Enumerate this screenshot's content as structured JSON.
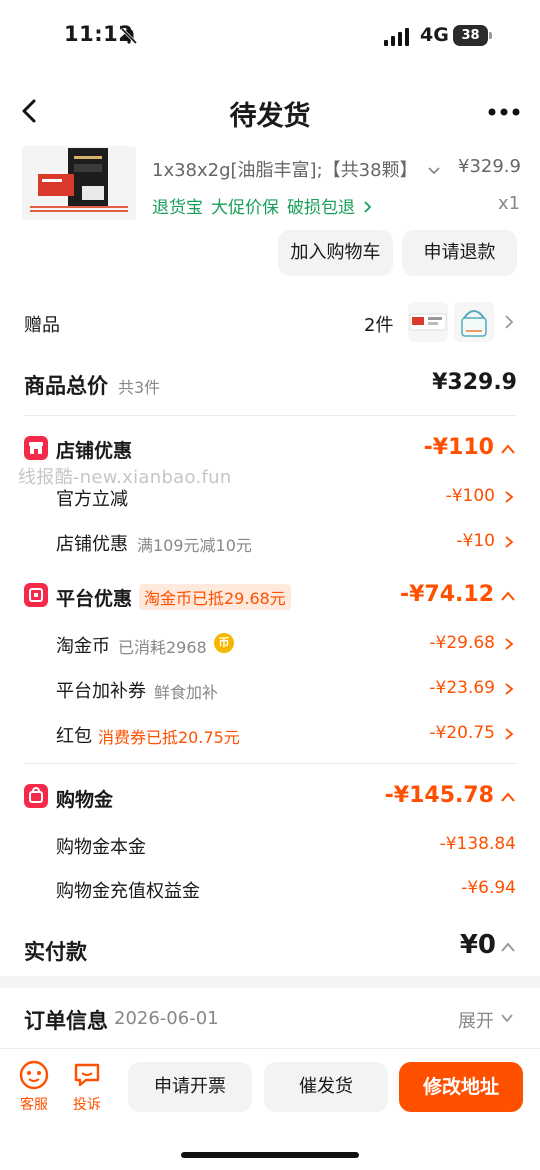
{
  "status": {
    "time": "11:12",
    "network": "4G",
    "battery": "38"
  },
  "header": {
    "title": "待发货"
  },
  "product": {
    "spec": "1x38x2g[油脂丰富];【共38颗】",
    "price": "¥329.9",
    "tags": [
      "退货宝",
      "大促价保",
      "破损包退"
    ],
    "qty": "x1",
    "cart_label": "加入购物车",
    "refund_label": "申请退款"
  },
  "gifts": {
    "label": "赠品",
    "count": "2件"
  },
  "total": {
    "label": "商品总价",
    "sub": "共3件",
    "value": "¥329.9"
  },
  "store_discount": {
    "title": "店铺优惠",
    "amount": "-¥110",
    "rows": [
      {
        "label": "官方立减",
        "sub": "",
        "amount": "-¥100"
      },
      {
        "label": "店铺优惠",
        "sub": "满109元减10元",
        "amount": "-¥10"
      }
    ]
  },
  "watermark": "线报酷-new.xianbao.fun",
  "platform_discount": {
    "title": "平台优惠",
    "tag": "淘金币已抵29.68元",
    "amount": "-¥74.12",
    "rows": [
      {
        "label": "淘金币",
        "sub": "已消耗2968",
        "amount": "-¥29.68"
      },
      {
        "label": "平台加补券",
        "sub": "鲜食加补",
        "amount": "-¥23.69"
      },
      {
        "label": "红包",
        "sub": "消费券已抵20.75元",
        "amount": "-¥20.75"
      }
    ],
    "coin_glyph": "币"
  },
  "shopping_gold": {
    "title": "购物金",
    "amount": "-¥145.78",
    "rows": [
      {
        "label": "购物金本金",
        "amount": "-¥138.84"
      },
      {
        "label": "购物金充值权益金",
        "amount": "-¥6.94"
      }
    ]
  },
  "payment": {
    "label": "实付款",
    "value": "¥0"
  },
  "order_info": {
    "label": "订单信息",
    "date": "2026-06-01",
    "expand_label": "展开"
  },
  "bottom_bar": {
    "service_label": "客服",
    "complain_label": "投诉",
    "invoice_label": "申请开票",
    "urge_label": "催发货",
    "address_label": "修改地址"
  },
  "colors": {
    "accent": "#ff5000",
    "green": "#18a058",
    "red_icon": "#f5294a"
  }
}
